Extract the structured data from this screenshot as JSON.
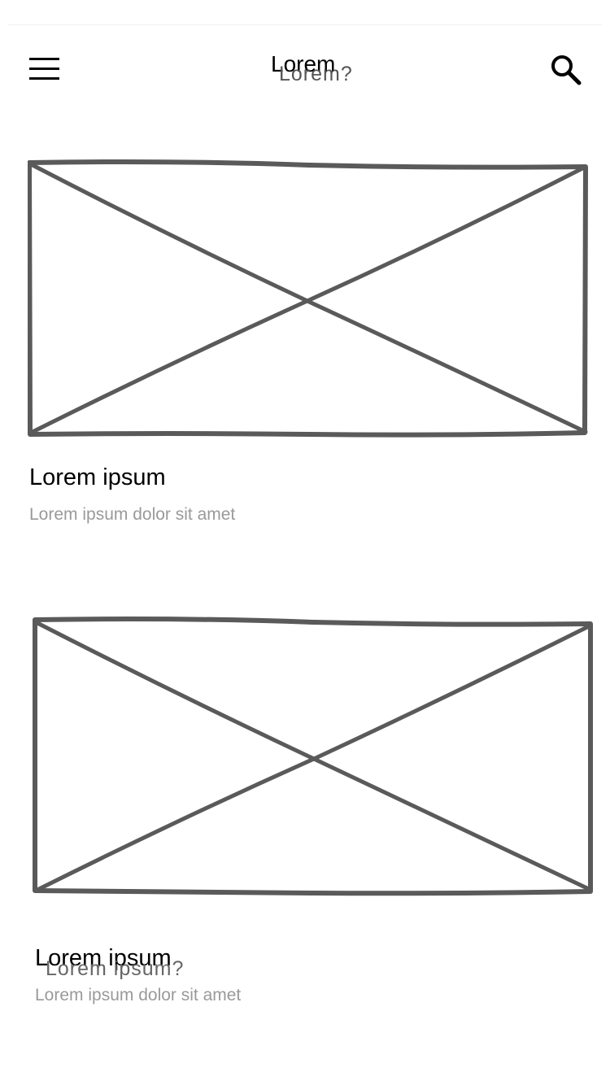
{
  "header": {
    "title": "Lorem",
    "title_overlay": "Lorem?"
  },
  "cards": [
    {
      "title": "Lorem ipsum",
      "subtitle": "Lorem ipsum dolor sit amet"
    },
    {
      "title": "Lorem ipsum",
      "title_overlay": "Lorem ipsum?",
      "subtitle": "Lorem ipsum dolor sit amet"
    }
  ],
  "icons": {
    "menu": "hamburger-menu-icon",
    "search": "search-icon",
    "image_placeholder": "image-placeholder-icon"
  },
  "colors": {
    "sketch_stroke": "#5a5a5a",
    "text_primary": "#000000",
    "text_secondary": "#9a9a9a"
  }
}
